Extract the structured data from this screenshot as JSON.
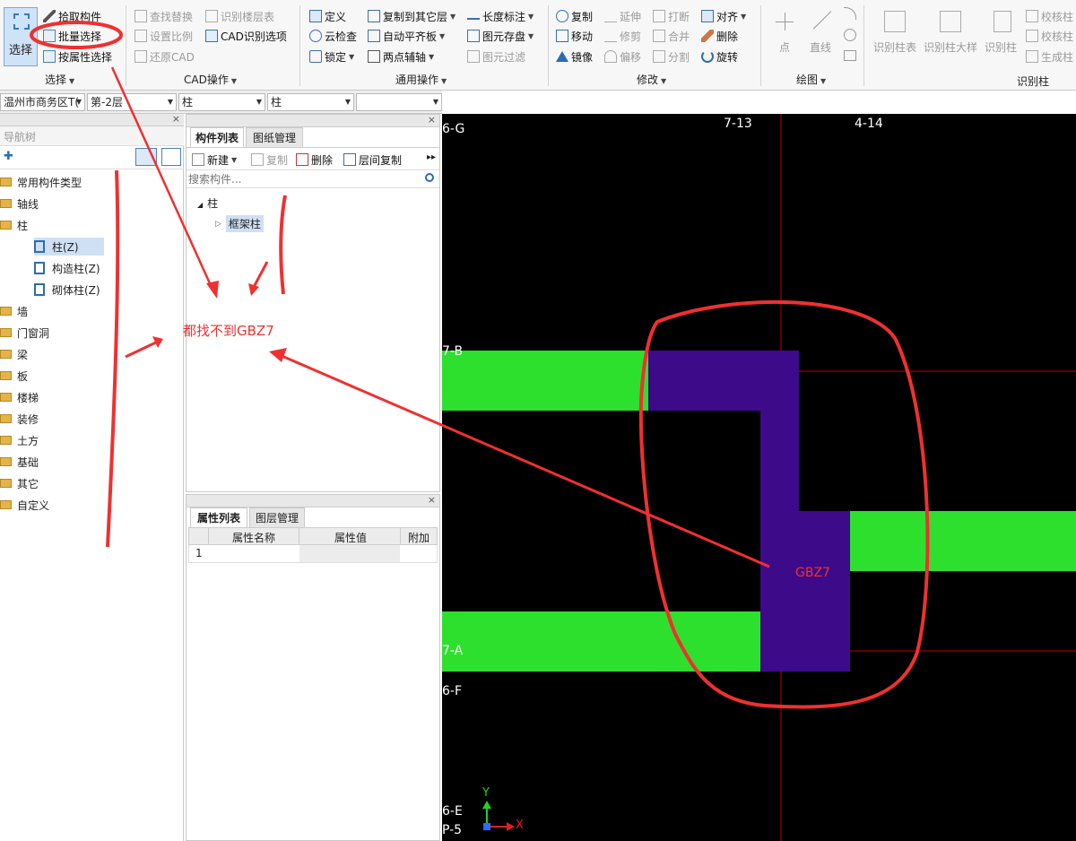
{
  "ribbon": {
    "select": {
      "big": "选择",
      "pick": "拾取构件",
      "batch": "批量选择",
      "byprop": "按属性选择",
      "group": "选择"
    },
    "cad": {
      "find": "查找替换",
      "floor": "识别楼层表",
      "scale": "设置比例",
      "cadopt": "CAD识别选项",
      "restore": "还原CAD",
      "group": "CAD操作"
    },
    "common": {
      "define": "定义",
      "copyto": "复制到其它层",
      "length": "长度标注",
      "cloud": "云检查",
      "autoflat": "自动平齐板",
      "elemsave": "图元存盘",
      "lock": "锁定",
      "twopt": "两点辅轴",
      "filter": "图元过滤",
      "group": "通用操作"
    },
    "modify": {
      "copy": "复制",
      "extend": "延伸",
      "break": "打断",
      "align": "对齐",
      "move": "移动",
      "trim": "修剪",
      "merge": "合并",
      "delete": "删除",
      "mirror": "镜像",
      "offset": "偏移",
      "split": "分割",
      "rotate": "旋转",
      "group": "修改"
    },
    "draw": {
      "point": "点",
      "line": "直线",
      "group": "绘图"
    },
    "identify": {
      "coltable": "识别柱表",
      "coldetail": "识别柱大样",
      "col": "识别柱",
      "check1": "校核柱",
      "check2": "校核柱",
      "gen": "生成柱",
      "group": "识别柱"
    }
  },
  "selectors": {
    "project": "温州市商务区T(",
    "floor": "第-2层",
    "type": "柱",
    "sub": "柱",
    "extra": ""
  },
  "nav": {
    "title": "导航树",
    "items": [
      "常用构件类型",
      "轴线",
      "柱",
      "柱(Z)",
      "构造柱(Z)",
      "砌体柱(Z)",
      "墙",
      "门窗洞",
      "梁",
      "板",
      "楼梯",
      "装修",
      "土方",
      "基础",
      "其它",
      "自定义"
    ]
  },
  "comp": {
    "tabs": [
      "构件列表",
      "图纸管理"
    ],
    "new": "新建",
    "copy": "复制",
    "delete": "删除",
    "floorcopy": "层间复制",
    "search_placeholder": "搜索构件...",
    "tree": [
      "柱",
      "框架柱"
    ]
  },
  "props": {
    "tabs": [
      "属性列表",
      "图层管理"
    ],
    "headers": [
      "属性名称",
      "属性值",
      "附加"
    ],
    "row1": "1"
  },
  "cad_view": {
    "axes": [
      "6-G",
      "7-13",
      "4-14",
      "7-B",
      "7-A",
      "6-F",
      "6-E",
      "P-5"
    ],
    "ucs_y": "Y",
    "ucs_x": "X"
  },
  "annotations": {
    "notfound": "都找不到GBZ7",
    "label": "GBZ7"
  },
  "colors": {
    "beam": "#2ee02e",
    "column": "#3d0a8a",
    "annotation": "#f03030",
    "grid": "#c00000"
  }
}
